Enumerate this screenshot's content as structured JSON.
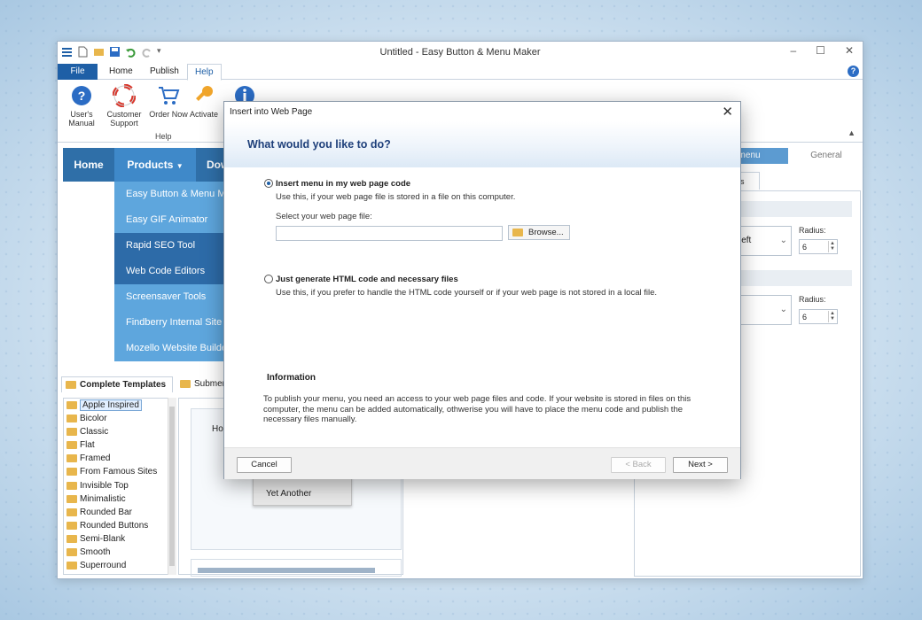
{
  "app": {
    "title": "Untitled - Easy Button & Menu Maker",
    "window_controls": [
      "–",
      "☐",
      "✕"
    ]
  },
  "ribbon": {
    "tabs": [
      "File",
      "Home",
      "Publish",
      "Help"
    ],
    "active_tab": "Help",
    "buttons": [
      {
        "label": "User's Manual",
        "icon": "help-circle-icon"
      },
      {
        "label": "Customer Support",
        "icon": "lifebuoy-icon"
      },
      {
        "label": "Order Now",
        "icon": "cart-icon"
      },
      {
        "label": "Activate",
        "icon": "key-icon"
      },
      {
        "label": "",
        "icon": "info-icon"
      }
    ],
    "group_label": "Help"
  },
  "preview_menu": {
    "items": [
      "Home",
      "Products",
      "Dow"
    ],
    "submenu": [
      {
        "label": "Easy Button & Menu Ma",
        "style": "light"
      },
      {
        "label": "Easy GIF Animator",
        "style": "light"
      },
      {
        "label": "Rapid SEO Tool",
        "style": "dark"
      },
      {
        "label": "Web Code Editors",
        "style": "dark"
      },
      {
        "label": "Screensaver Tools",
        "style": "light"
      },
      {
        "label": "Findberry Internal Site S",
        "style": "light"
      },
      {
        "label": "Mozello Website Builder",
        "style": "light"
      }
    ]
  },
  "right_panel": {
    "tab_active": "bmenu",
    "tab_general": "General",
    "subtab": "ners",
    "combo1": "left",
    "combo2": "",
    "radius_label": "Radius:",
    "radius1": "6",
    "radius2": "6"
  },
  "templates": {
    "tab_complete": "Complete Templates",
    "tab_submenu": "Submen",
    "items": [
      "Apple Inspired",
      "Bicolor",
      "Classic",
      "Flat",
      "Framed",
      "From Famous Sites",
      "Invisible Top",
      "Minimalistic",
      "Rounded Bar",
      "Rounded Buttons",
      "Semi-Blank",
      "Smooth",
      "Superround"
    ],
    "selected": "Apple Inspired",
    "preview_label_home": "Ho",
    "preview_label_another": "Yet Another"
  },
  "dialog": {
    "title": "Insert into Web Page",
    "question": "What would you like to do?",
    "option1_title": "Insert menu in my web page code",
    "option1_desc": "Use this, if your web page file is stored in a file on this computer.",
    "file_label": "Select your web page file:",
    "file_value": "",
    "browse_label": "Browse...",
    "option2_title": "Just generate HTML code and necessary files",
    "option2_desc": "Use this, if you prefer to handle the HTML code yourself or if your web page is not stored in a local file.",
    "info_heading": "Information",
    "info_text": "To publish your menu, you need an access to your web page files and code. If your website is stored in files on this computer, the menu can be added automatically, othwerise you will have to place the menu code and publish the necessary files manually.",
    "cancel_label": "Cancel",
    "back_label": "< Back",
    "next_label": "Next >",
    "selected_option": 1
  }
}
